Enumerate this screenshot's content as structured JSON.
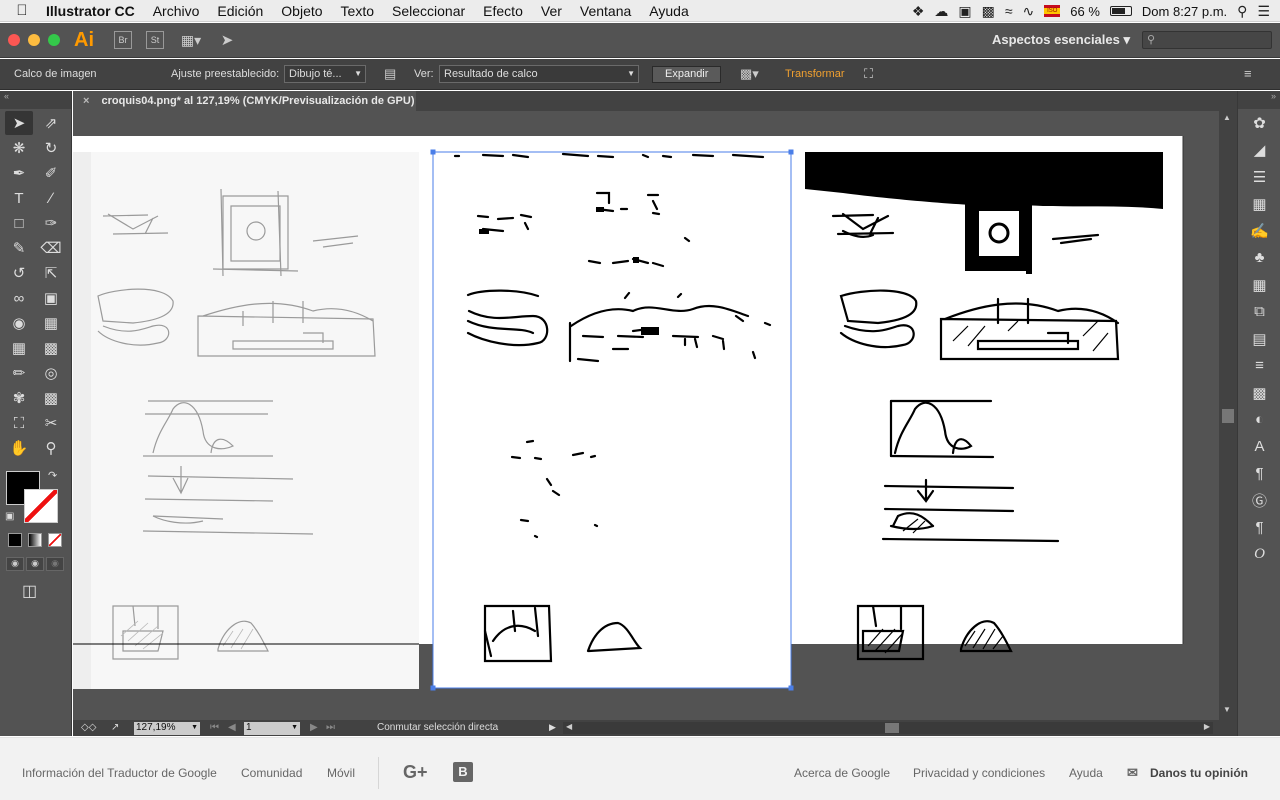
{
  "menubar": {
    "app_name": "Illustrator CC",
    "items": [
      "Archivo",
      "Edición",
      "Objeto",
      "Texto",
      "Seleccionar",
      "Efecto",
      "Ver",
      "Ventana",
      "Ayuda"
    ],
    "flag_text": "ISO",
    "battery": "66 %",
    "clock": "Dom 8:27 p.m."
  },
  "appbar": {
    "logo": "Ai",
    "bridge": "Br",
    "stock": "St",
    "workspace": "Aspectos esenciales"
  },
  "controlbar": {
    "title": "Calco de imagen",
    "preset_label": "Ajuste preestablecido:",
    "preset_value": "Dibujo té...",
    "view_label": "Ver:",
    "view_value": "Resultado de calco",
    "expand_button": "Expandir",
    "transform_link": "Transformar"
  },
  "document": {
    "tab_title": "croquis04.png* al 127,19% (CMYK/Previsualización de GPU)"
  },
  "statusbar": {
    "zoom": "127,19%",
    "page": "1",
    "mode": "Conmutar selección directa"
  },
  "google_footer": {
    "left_links": [
      "Información del Traductor de Google",
      "Comunidad",
      "Móvil"
    ],
    "right_links": [
      "Acerca de Google",
      "Privacidad y condiciones",
      "Ayuda"
    ],
    "feedback": "Danos tu opinión"
  }
}
